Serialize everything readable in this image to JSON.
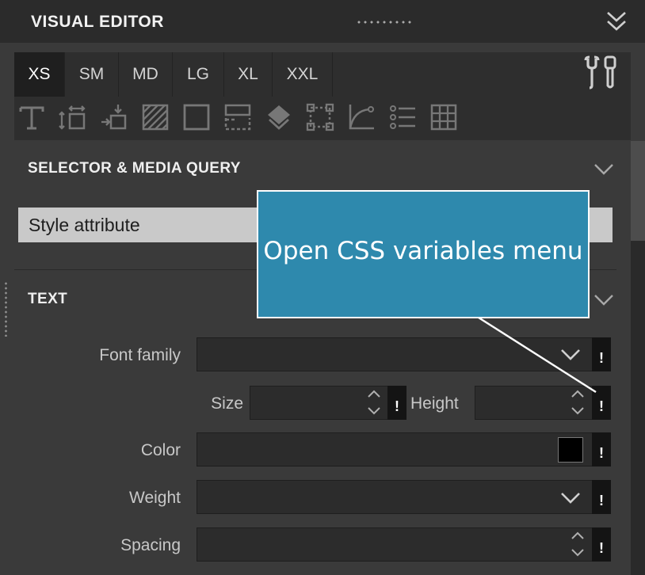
{
  "header": {
    "title": "VISUAL EDITOR",
    "grip_icon": "drag-handle-dots",
    "collapse_icon": "double-chevron-down"
  },
  "breakpoint_tabs": [
    {
      "label": "XS",
      "active": true
    },
    {
      "label": "SM",
      "active": false
    },
    {
      "label": "MD",
      "active": false
    },
    {
      "label": "LG",
      "active": false
    },
    {
      "label": "XL",
      "active": false
    },
    {
      "label": "XXL",
      "active": false
    }
  ],
  "tools_icon": "wrench-screwdriver",
  "property_icons": [
    "text-T",
    "margin-padding",
    "position",
    "background-hatch",
    "border-box",
    "layout",
    "effects-layers",
    "box-selection",
    "curve-transition",
    "list",
    "grid-table"
  ],
  "selector_section": {
    "title": "SELECTOR & MEDIA QUERY",
    "selected_value": "Style attribute"
  },
  "text_section": {
    "title": "TEXT",
    "fields": {
      "font_family": {
        "label": "Font family",
        "value": ""
      },
      "size": {
        "label": "Size",
        "value": ""
      },
      "height": {
        "label": "Height",
        "value": ""
      },
      "color": {
        "label": "Color",
        "value": "#000000"
      },
      "weight": {
        "label": "Weight",
        "value": ""
      },
      "spacing": {
        "label": "Spacing",
        "value": ""
      }
    },
    "css_var_marker": "!"
  },
  "callout": {
    "text": "Open CSS variables menu"
  },
  "colors": {
    "accent_callout": "#2e89ad",
    "panel_bg": "#3a3a3a",
    "header_bg": "#2b2b2b"
  }
}
